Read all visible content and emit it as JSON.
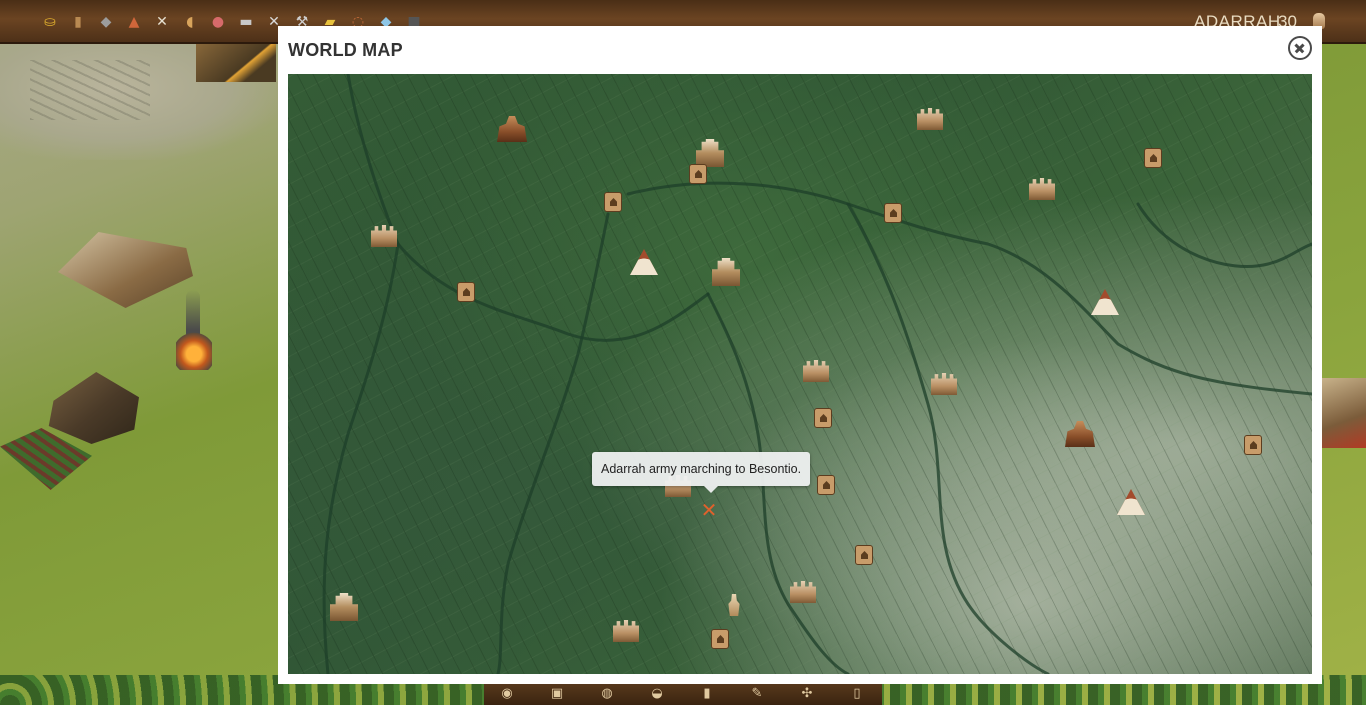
{
  "topbar": {
    "resources": [
      {
        "icon": "gold-icon",
        "glyph": "⛀",
        "color": "#e0b02e"
      },
      {
        "icon": "wood-icon",
        "glyph": "▮",
        "color": "#b98a52"
      },
      {
        "icon": "stone-icon",
        "glyph": "◆",
        "color": "#9c9c9c"
      },
      {
        "icon": "copper-icon",
        "glyph": "▲",
        "color": "#d0663a"
      },
      {
        "icon": "tools-icon",
        "glyph": "✕",
        "color": "#e6e0d0"
      },
      {
        "icon": "bread-icon",
        "glyph": "◖",
        "color": "#d8a45c"
      },
      {
        "icon": "meat-icon",
        "glyph": "●",
        "color": "#d66a6a"
      },
      {
        "icon": "cloth-icon",
        "glyph": "▬",
        "color": "#c9c9c9"
      },
      {
        "icon": "swords-icon",
        "glyph": "✕",
        "color": "#d9d9d9"
      },
      {
        "icon": "hammer-icon",
        "glyph": "⚒",
        "color": "#cfcfcf"
      },
      {
        "icon": "gold-bar-icon",
        "glyph": "▰",
        "color": "#e8c23c"
      },
      {
        "icon": "rope-icon",
        "glyph": "◌",
        "color": "#c56c3a"
      },
      {
        "icon": "crystal-icon",
        "glyph": "◆",
        "color": "#8ec6e6"
      },
      {
        "icon": "coal-icon",
        "glyph": "■",
        "color": "#555555"
      }
    ],
    "player_name": "ADARRAH",
    "player_level": "30"
  },
  "modal": {
    "title": "WORLD MAP",
    "close_icon": "close-icon"
  },
  "map": {
    "tooltip": "Adarrah army marching to Besontio.",
    "army_icon": "crossed-swords-icon",
    "markers": [
      {
        "type": "capital",
        "name": "city-marker"
      },
      {
        "type": "fort",
        "name": "fort-marker"
      },
      {
        "type": "village",
        "name": "village-marker"
      },
      {
        "type": "castle",
        "name": "castle-marker"
      },
      {
        "type": "tent",
        "name": "camp-marker"
      },
      {
        "type": "statue",
        "name": "monument-marker"
      }
    ]
  },
  "bottombar": {
    "tools": [
      "◉",
      "▣",
      "◍",
      "◒",
      "▮",
      "✎",
      "✣",
      "▯"
    ]
  }
}
